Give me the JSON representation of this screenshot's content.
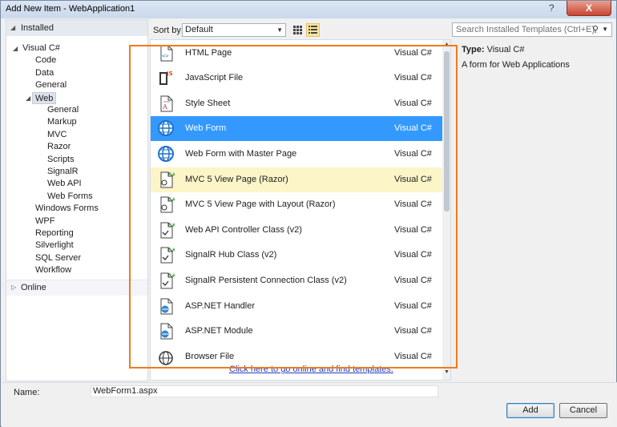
{
  "window": {
    "title": "Add New Item - WebApplication1",
    "help": "?",
    "close": "X"
  },
  "tree": {
    "installed": "Installed",
    "online": "Online",
    "items": [
      {
        "label": "Visual C#",
        "level": 1,
        "expanded": true
      },
      {
        "label": "Code",
        "level": 2
      },
      {
        "label": "Data",
        "level": 2
      },
      {
        "label": "General",
        "level": 2
      },
      {
        "label": "Web",
        "level": 2,
        "expanded": true,
        "selected": true
      },
      {
        "label": "General",
        "level": 3
      },
      {
        "label": "Markup",
        "level": 3
      },
      {
        "label": "MVC",
        "level": 3
      },
      {
        "label": "Razor",
        "level": 3
      },
      {
        "label": "Scripts",
        "level": 3
      },
      {
        "label": "SignalR",
        "level": 3
      },
      {
        "label": "Web API",
        "level": 3
      },
      {
        "label": "Web Forms",
        "level": 3
      },
      {
        "label": "Windows Forms",
        "level": 2
      },
      {
        "label": "WPF",
        "level": 2
      },
      {
        "label": "Reporting",
        "level": 2
      },
      {
        "label": "Silverlight",
        "level": 2
      },
      {
        "label": "SQL Server",
        "level": 2
      },
      {
        "label": "Workflow",
        "level": 2
      }
    ]
  },
  "toolbar": {
    "sort_label": "Sort by:",
    "sort_value": "Default",
    "search_placeholder": "Search Installed Templates (Ctrl+E)"
  },
  "templates": [
    {
      "name": "HTML Page",
      "lang": "Visual C#",
      "icon": "html-page-icon"
    },
    {
      "name": "JavaScript File",
      "lang": "Visual C#",
      "icon": "javascript-file-icon"
    },
    {
      "name": "Style Sheet",
      "lang": "Visual C#",
      "icon": "style-sheet-icon"
    },
    {
      "name": "Web Form",
      "lang": "Visual C#",
      "icon": "globe-icon",
      "selected": true
    },
    {
      "name": "Web Form with Master Page",
      "lang": "Visual C#",
      "icon": "globe-icon"
    },
    {
      "name": "MVC 5 View Page (Razor)",
      "lang": "Visual C#",
      "icon": "razor-page-icon",
      "hover": true
    },
    {
      "name": "MVC 5 View Page with Layout (Razor)",
      "lang": "Visual C#",
      "icon": "razor-page-icon"
    },
    {
      "name": "Web API Controller Class (v2)",
      "lang": "Visual C#",
      "icon": "csharp-class-icon"
    },
    {
      "name": "SignalR Hub Class (v2)",
      "lang": "Visual C#",
      "icon": "csharp-class-icon"
    },
    {
      "name": "SignalR Persistent Connection Class (v2)",
      "lang": "Visual C#",
      "icon": "csharp-class-icon"
    },
    {
      "name": "ASP.NET Handler",
      "lang": "Visual C#",
      "icon": "handler-icon"
    },
    {
      "name": "ASP.NET Module",
      "lang": "Visual C#",
      "icon": "module-icon"
    },
    {
      "name": "Browser File",
      "lang": "Visual C#",
      "icon": "browser-file-icon"
    }
  ],
  "online_link": "Click here to go online and find templates.",
  "details": {
    "type_label": "Type:",
    "type_value": "Visual C#",
    "description": "A form for Web Applications"
  },
  "bottom": {
    "name_label": "Name:",
    "name_value": "WebForm1.aspx",
    "add_label": "Add",
    "cancel_label": "Cancel"
  },
  "colors": {
    "selection": "#3399ff",
    "hover": "#fcf5c8",
    "highlight_box": "#f07b1d",
    "link": "#1f3fc4"
  }
}
